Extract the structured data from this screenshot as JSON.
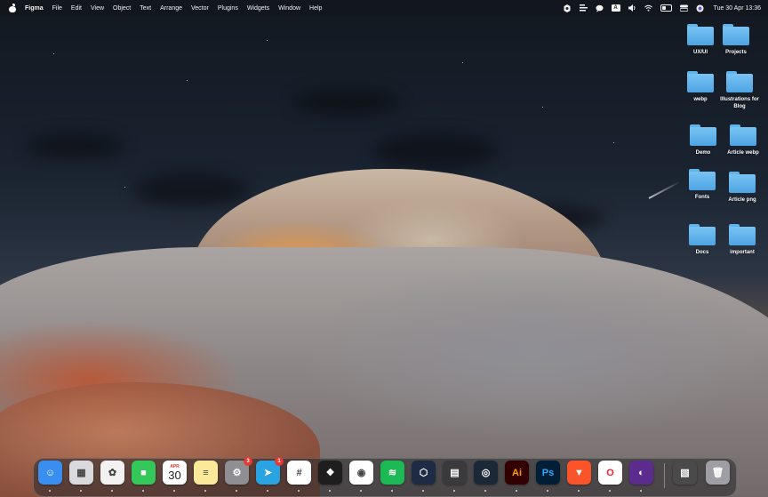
{
  "menubar": {
    "app_name": "Figma",
    "menus": [
      "File",
      "Edit",
      "View",
      "Object",
      "Text",
      "Arrange",
      "Vector",
      "Plugins",
      "Widgets",
      "Window",
      "Help"
    ],
    "status_icons": [
      "figma-icon",
      "stack-icon",
      "chat-icon",
      "keyboard-layout-icon",
      "speaker-icon",
      "wifi-icon",
      "battery-icon",
      "control-center-icon",
      "siri-icon"
    ],
    "keyboard_layout": "A",
    "clock": "Tue 30 Apr  13:36"
  },
  "desktop": {
    "folders": [
      {
        "label": "UX/UI"
      },
      {
        "label": "Projects"
      },
      {
        "label": "webp"
      },
      {
        "label": "Illustrations for Blog"
      },
      {
        "label": "Demo"
      },
      {
        "label": "Article webp"
      },
      {
        "label": "Fonts"
      },
      {
        "label": "Article png"
      },
      {
        "label": "Docs"
      },
      {
        "label": "important"
      }
    ]
  },
  "dock": {
    "apps": [
      {
        "name": "Finder",
        "icon": "finder-icon",
        "color": "#3a8ef0",
        "glyph": "☺"
      },
      {
        "name": "Launchpad",
        "icon": "launchpad-icon",
        "color": "#d9d9de",
        "glyph": "▦"
      },
      {
        "name": "Photos",
        "icon": "photos-icon",
        "color": "#f2f2f2",
        "glyph": "✿"
      },
      {
        "name": "FaceTime",
        "icon": "facetime-icon",
        "color": "#34c759",
        "glyph": "■"
      },
      {
        "name": "Calendar",
        "icon": "calendar-icon",
        "color": "#ffffff",
        "month": "APR",
        "day": "30"
      },
      {
        "name": "Notes",
        "icon": "notes-icon",
        "color": "#fbe99a",
        "glyph": "≡"
      },
      {
        "name": "System Settings",
        "icon": "settings-icon",
        "color": "#8e8e93",
        "glyph": "⚙",
        "badge": "3"
      },
      {
        "name": "Telegram",
        "icon": "telegram-icon",
        "color": "#2aa3e3",
        "glyph": "➤",
        "badge": "1"
      },
      {
        "name": "Slack",
        "icon": "slack-icon",
        "color": "#ffffff",
        "glyph": "#"
      },
      {
        "name": "Figma",
        "icon": "figma-app-icon",
        "color": "#1e1e1e",
        "glyph": "❖"
      },
      {
        "name": "Chrome",
        "icon": "chrome-icon",
        "color": "#ffffff",
        "glyph": "◉"
      },
      {
        "name": "Spotify",
        "icon": "spotify-icon",
        "color": "#1db954",
        "glyph": "≋"
      },
      {
        "name": "Bitwarden",
        "icon": "hexagon-app-icon",
        "color": "#1f2a44",
        "glyph": "⬡"
      },
      {
        "name": "Calculator",
        "icon": "calculator-icon",
        "color": "#3a3a3c",
        "glyph": "▤"
      },
      {
        "name": "Steam",
        "icon": "steam-icon",
        "color": "#1b2838",
        "glyph": "◎"
      },
      {
        "name": "Illustrator",
        "icon": "illustrator-icon",
        "color": "#330000",
        "glyph": "Ai",
        "glyph_color": "#ff9a00"
      },
      {
        "name": "Photoshop",
        "icon": "photoshop-icon",
        "color": "#001e36",
        "glyph": "Ps",
        "glyph_color": "#31a8ff"
      },
      {
        "name": "Brave",
        "icon": "brave-icon",
        "color": "#fb542b",
        "glyph": "▼"
      },
      {
        "name": "Opera",
        "icon": "opera-icon",
        "color": "#ffffff",
        "glyph": "O",
        "glyph_color": "#ff1b2d"
      },
      {
        "name": "Firefox",
        "icon": "firefox-icon",
        "color": "#5b2c8e",
        "glyph": "◐"
      },
      {
        "name": "Screenshot",
        "icon": "screenshot-icon",
        "color": "#4a4a4a",
        "glyph": "▧"
      },
      {
        "name": "Trash",
        "icon": "trash-icon",
        "color": "#9e9ea4",
        "glyph": "🗑"
      }
    ]
  }
}
